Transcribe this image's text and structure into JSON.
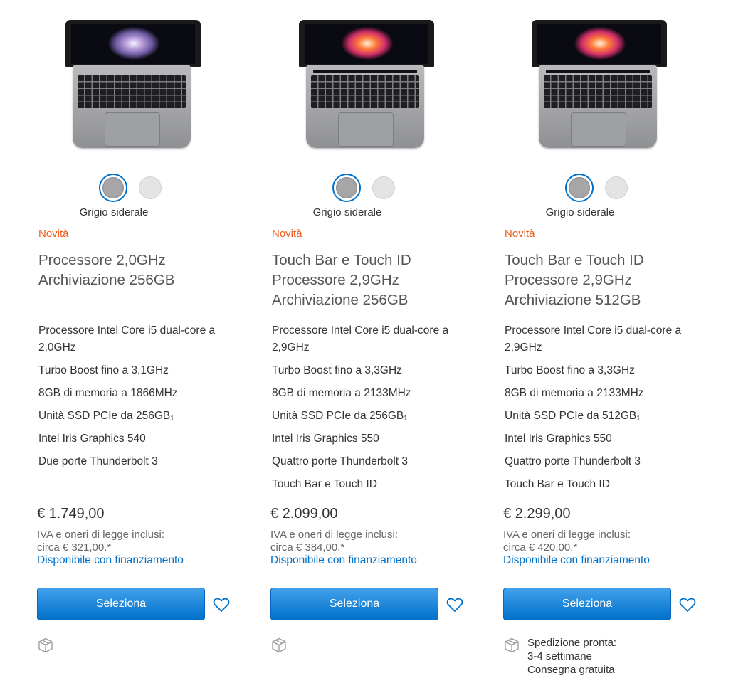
{
  "products": [
    {
      "screen": "standard",
      "color_label": "Grigio siderale",
      "swatches": [
        "Grigio siderale",
        "Argento"
      ],
      "badge": "Novità",
      "title_lines": [
        "Processore 2,0GHz",
        "Archiviazione 256GB"
      ],
      "specs": [
        "Processore Intel Core i5 dual-core a 2,0GHz",
        "Turbo Boost fino a 3,1GHz",
        "8GB di memoria a 1866MHz",
        "Unità SSD PCIe da 256GB₁",
        "Intel Iris Graphics 540",
        "Due porte Thunderbolt 3"
      ],
      "price": "€ 1.749,00",
      "tax_line1": "IVA e oneri di legge inclusi:",
      "tax_line2": "circa € 321,00.*",
      "finance_link": "Disponibile con finanziamento",
      "select_label": "Seleziona",
      "shipping": []
    },
    {
      "screen": "touchbar",
      "color_label": "Grigio siderale",
      "swatches": [
        "Grigio siderale",
        "Argento"
      ],
      "badge": "Novità",
      "title_lines": [
        "Touch Bar e Touch ID",
        "Processore 2,9GHz",
        "Archiviazione 256GB"
      ],
      "specs": [
        "Processore Intel Core i5 dual-core a 2,9GHz",
        "Turbo Boost fino a 3,3GHz",
        "8GB di memoria a 2133MHz",
        "Unità SSD PCIe da 256GB₁",
        "Intel Iris Graphics 550",
        "Quattro porte Thunderbolt 3",
        "Touch Bar e Touch ID"
      ],
      "price": "€ 2.099,00",
      "tax_line1": "IVA e oneri di legge inclusi:",
      "tax_line2": "circa € 384,00.*",
      "finance_link": "Disponibile con finanziamento",
      "select_label": "Seleziona",
      "shipping": []
    },
    {
      "screen": "touchbar",
      "color_label": "Grigio siderale",
      "swatches": [
        "Grigio siderale",
        "Argento"
      ],
      "badge": "Novità",
      "title_lines": [
        "Touch Bar e Touch ID",
        "Processore 2,9GHz",
        "Archiviazione 512GB"
      ],
      "specs": [
        "Processore Intel Core i5 dual-core a 2,9GHz",
        "Turbo Boost fino a 3,3GHz",
        "8GB di memoria a 2133MHz",
        "Unità SSD PCIe da 512GB₁",
        "Intel Iris Graphics 550",
        "Quattro porte Thunderbolt 3",
        "Touch Bar e Touch ID"
      ],
      "price": "€ 2.299,00",
      "tax_line1": "IVA e oneri di legge inclusi:",
      "tax_line2": "circa € 420,00.*",
      "finance_link": "Disponibile con finanziamento",
      "select_label": "Seleziona",
      "shipping": [
        "Spedizione pronta:",
        "3-4 settimane",
        "Consegna gratuita"
      ]
    }
  ],
  "colors": {
    "accent_blue": "#0070c9",
    "new_badge": "#ef5b1a"
  },
  "icons": {
    "favorite": "heart-icon",
    "shipping": "box-icon"
  }
}
